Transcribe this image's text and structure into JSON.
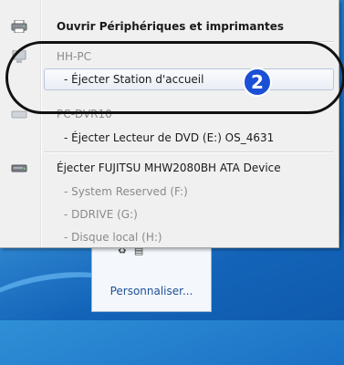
{
  "menu": {
    "open_devices": "Ouvrir Périphériques et imprimantes",
    "group1_header": "HH-PC",
    "group1_item": "- Éjecter Station d'accueil",
    "group2_header": "PC-DVR10",
    "group2_item": "- Éjecter Lecteur de DVD (E:) OS_4631",
    "group3_header": "Éjecter FUJITSU MHW2080BH ATA Device",
    "group3_items": [
      "- System Reserved (F:)",
      "- DDRIVE (G:)",
      "- Disque local (H:)"
    ]
  },
  "callout": {
    "number": "2"
  },
  "notification": {
    "customize_label": "Personnaliser..."
  },
  "icons": {
    "devices_printers": "printer-icon",
    "pc": "computer-icon",
    "dock": "docking-station-icon",
    "drive": "hard-drive-icon"
  }
}
